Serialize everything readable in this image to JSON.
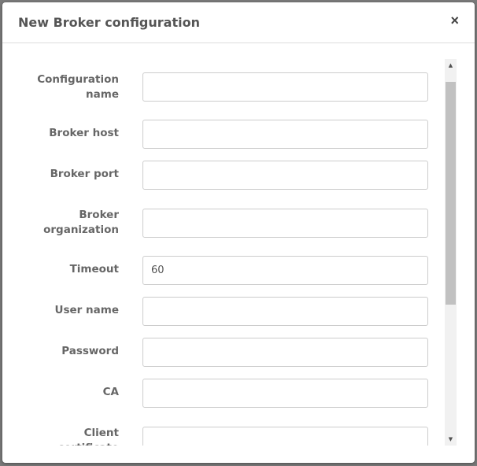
{
  "dialog": {
    "title": "New Broker configuration",
    "close_label": "×"
  },
  "fields": [
    {
      "label": "Configuration name",
      "value": ""
    },
    {
      "label": "Broker host",
      "value": ""
    },
    {
      "label": "Broker port",
      "value": ""
    },
    {
      "label": "Broker organization",
      "value": ""
    },
    {
      "label": "Timeout",
      "value": "60"
    },
    {
      "label": "User name",
      "value": ""
    },
    {
      "label": "Password",
      "value": ""
    },
    {
      "label": "CA",
      "value": ""
    },
    {
      "label": "Client certificate",
      "value": ""
    }
  ],
  "scrollbar": {
    "up": "▲",
    "down": "▼"
  }
}
